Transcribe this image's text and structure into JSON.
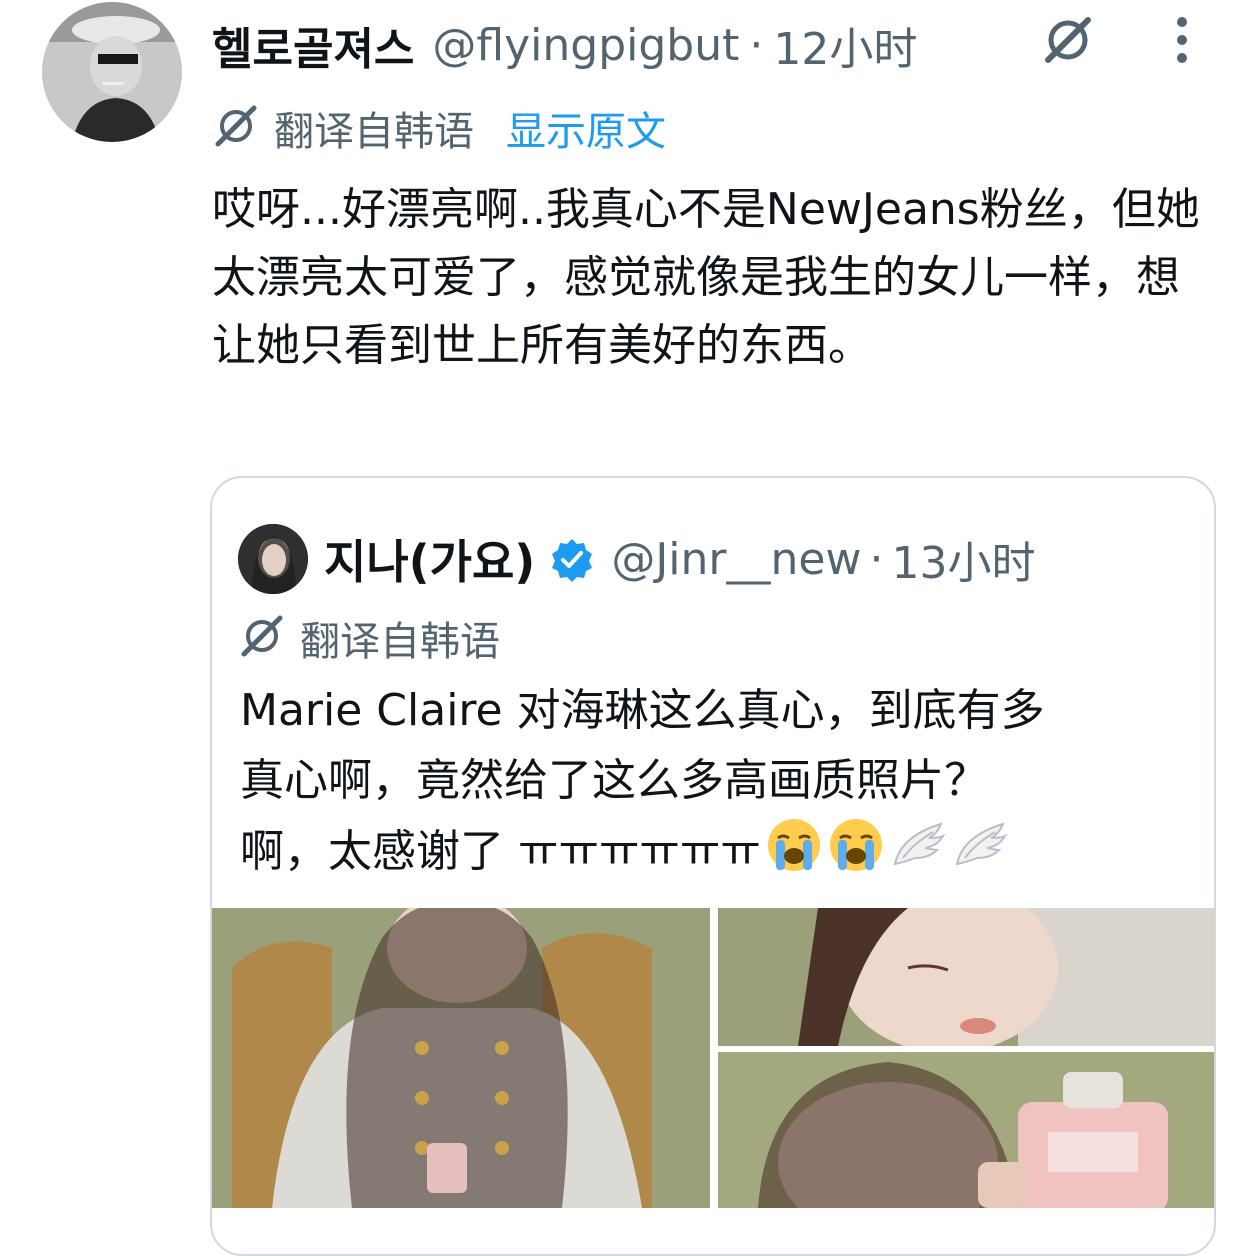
{
  "tweet": {
    "display_name": "헬로골져스",
    "handle": "@flyingpigbut",
    "separator": "·",
    "time": "12小时",
    "translate_label": "翻译自韩语",
    "show_original_label": "显示原文",
    "text": "哎呀...好漂亮啊..我真心不是NewJeans粉丝，但她太漂亮太可爱了，感觉就像是我生的女儿一样，想让她只看到世上所有美好的东西。"
  },
  "quote": {
    "display_name": "지나(가요)",
    "handle": "@Jinr__new",
    "separator": "·",
    "time": "13小时",
    "translate_label": "翻译自韩语",
    "text_line1": "Marie Claire 对海琳这么真心，到底有多",
    "text_line2": "真心啊，竟然给了这么多高画质照片？",
    "text_line3": "啊，太感谢了 ㅠㅠㅠㅠㅠㅠ"
  },
  "icons": {
    "translate": "translate-icon",
    "grok": "grok-icon",
    "more": "more-vertical-icon",
    "verified": "verified-badge-icon",
    "crying": "loudly-crying-face-emoji",
    "wing": "wing-emoji"
  },
  "colors": {
    "link_blue": "#1d9bf0",
    "secondary_text": "#536471",
    "border": "#cfd9de"
  }
}
